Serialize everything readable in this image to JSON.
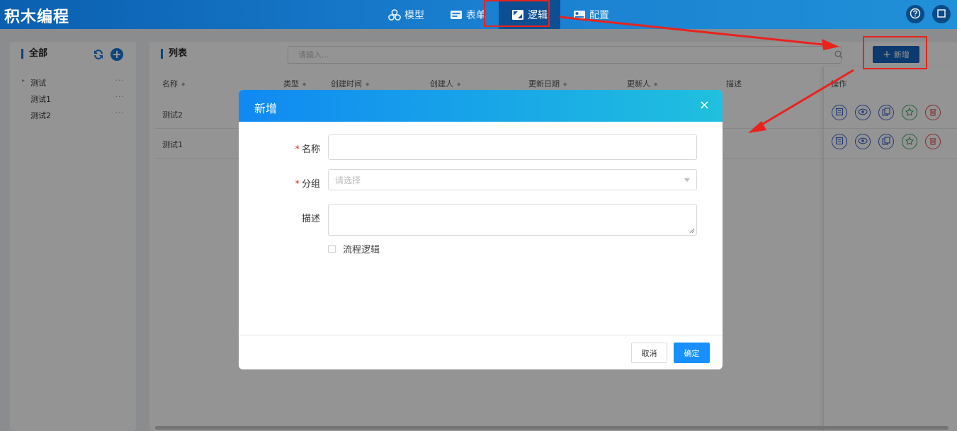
{
  "app": {
    "title": "积木编程"
  },
  "nav": {
    "items": [
      {
        "label": "模型",
        "icon": "cubes-icon"
      },
      {
        "label": "表单",
        "icon": "form-icon"
      },
      {
        "label": "逻辑",
        "icon": "logic-icon",
        "active": true
      },
      {
        "label": "配置",
        "icon": "config-icon"
      }
    ]
  },
  "header_buttons": [
    {
      "icon": "help-icon"
    },
    {
      "icon": "fullscreen-icon"
    }
  ],
  "sidebar": {
    "title": "全部",
    "refresh_icon": "refresh-icon",
    "add_icon": "plus-icon",
    "items": [
      {
        "label": "测试",
        "expandable": true
      },
      {
        "label": "测试1"
      },
      {
        "label": "测试2"
      }
    ],
    "more_label": "···"
  },
  "list": {
    "title": "列表",
    "search_placeholder": "请输入...",
    "add_button": "新增",
    "columns": [
      "名称",
      "类型",
      "创建时间",
      "创建人",
      "更新日期",
      "更新人",
      "描述",
      "操作"
    ],
    "rows": [
      {
        "name": "测试2"
      },
      {
        "name": "测试1"
      }
    ],
    "row_actions": [
      "edit-icon",
      "view-icon",
      "copy-icon",
      "publish-icon",
      "delete-icon"
    ]
  },
  "modal": {
    "title": "新增",
    "close": "×",
    "fields": {
      "name": {
        "label": "名称",
        "required": true,
        "value": ""
      },
      "group": {
        "label": "分组",
        "required": true,
        "placeholder": "请选择"
      },
      "desc": {
        "label": "描述",
        "required": false,
        "value": ""
      }
    },
    "required_mark": "*",
    "checkbox_label": "流程逻辑",
    "cancel": "取消",
    "ok": "确定"
  },
  "colors": {
    "header": "#1a7fd0",
    "primary": "#1890ff",
    "annotation": "#e8231c"
  }
}
